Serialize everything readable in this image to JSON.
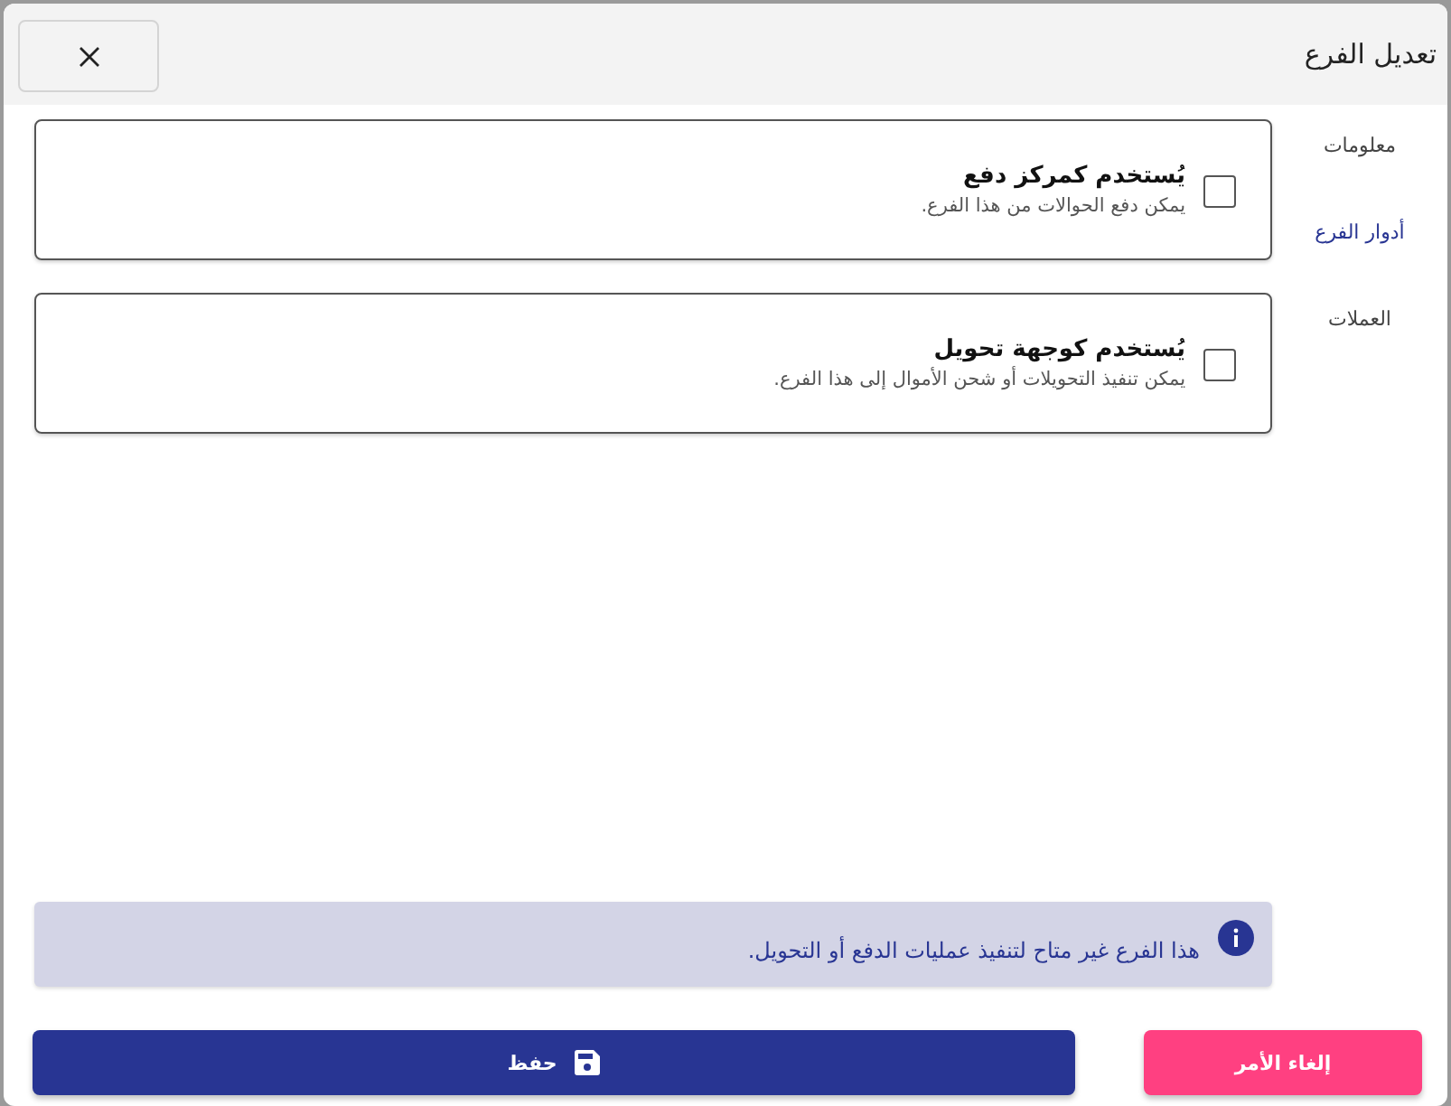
{
  "dialog": {
    "title": "تعديل الفرع"
  },
  "sidebar": {
    "items": [
      {
        "label": "معلومات",
        "selected": false
      },
      {
        "label": "أدوار الفرع",
        "selected": true
      },
      {
        "label": "العملات",
        "selected": false
      }
    ]
  },
  "roles": [
    {
      "title": "يُستخدم كمركز دفع",
      "description": "يمكن دفع الحوالات من هذا الفرع.",
      "checked": false
    },
    {
      "title": "يُستخدم كوجهة تحويل",
      "description": "يمكن تنفيذ التحويلات أو شحن الأموال إلى هذا الفرع.",
      "checked": false
    }
  ],
  "alert": {
    "text": "هذا الفرع غير متاح لتنفيذ عمليات الدفع أو التحويل."
  },
  "buttons": [
    {
      "kind": "cancel",
      "label": "إلغاء الأمر"
    },
    {
      "kind": "save",
      "label": "حفظ"
    }
  ]
}
